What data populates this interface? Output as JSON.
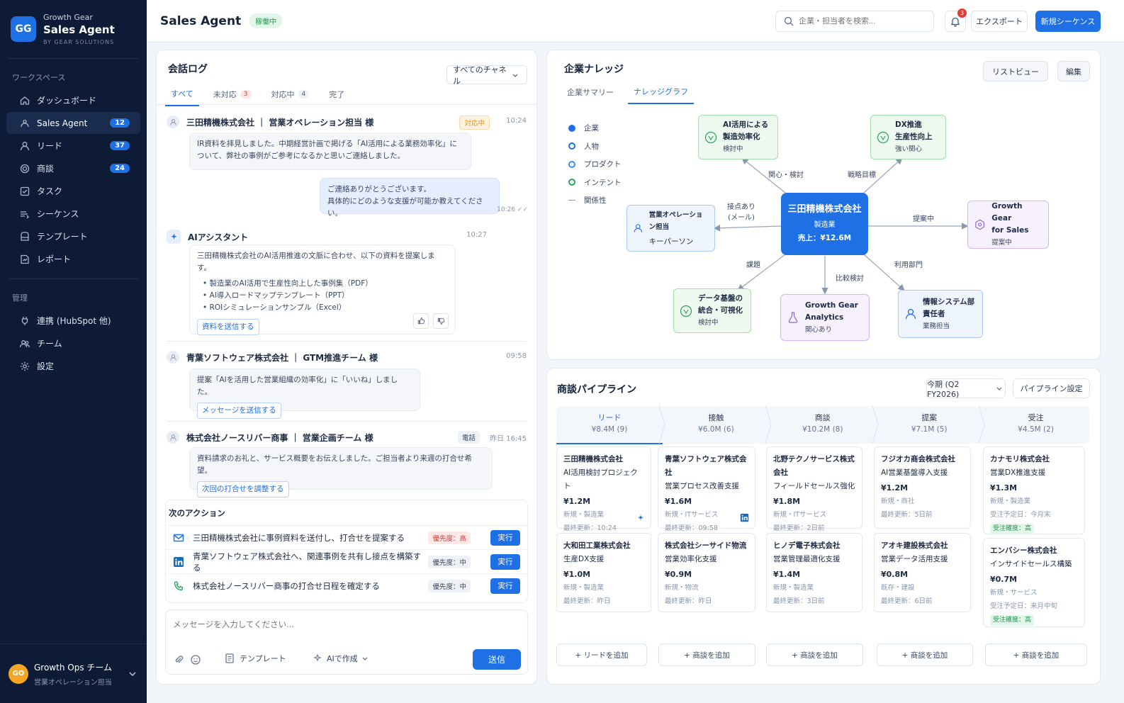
{
  "sidebar": {
    "logo": "GG",
    "brand_small": "Growth Gear",
    "brand_large": "Sales Agent",
    "brand_by": "BY GEAR SOLUTIONS",
    "workspace_label": "ワークスペース",
    "workspace_items": [
      {
        "label": "ダッシュボード",
        "icon": "home-icon"
      },
      {
        "label": "Sales Agent",
        "badge": "12",
        "icon": "agent-icon"
      },
      {
        "label": "リード",
        "badge": "37",
        "icon": "person-icon"
      },
      {
        "label": "商談",
        "badge": "24",
        "icon": "target-icon"
      },
      {
        "label": "タスク",
        "icon": "task-icon"
      },
      {
        "label": "シーケンス",
        "icon": "sequence-icon"
      },
      {
        "label": "テンプレート",
        "icon": "template-icon"
      },
      {
        "label": "レポート",
        "icon": "report-icon"
      }
    ],
    "admin_label": "管理",
    "admin_items": [
      {
        "label": "連携 (HubSpot 他)",
        "icon": "plug-icon"
      },
      {
        "label": "チーム",
        "icon": "team-icon"
      },
      {
        "label": "設定",
        "icon": "gear-icon"
      }
    ],
    "user": {
      "avatar": "GO",
      "name": "Growth Ops チーム",
      "role": "営業オペレーション担当"
    }
  },
  "topbar": {
    "title": "Sales Agent",
    "status": "稼働中",
    "search_placeholder": "企業・担当者を検索...",
    "notif_count": "3",
    "export": "エクスポート",
    "new_sequence": "新規シーケンス"
  },
  "conversation": {
    "title": "会話ログ",
    "channel_filter": "すべてのチャネル",
    "tabs": [
      {
        "label": "すべて"
      },
      {
        "label": "未対応",
        "count": "3"
      },
      {
        "label": "対応中",
        "count": "4"
      },
      {
        "label": "完了"
      }
    ],
    "thread1": {
      "name": "三田精機株式会社 ｜ 営業オペレーション担当 様",
      "tag": "対応中",
      "time": "10:24",
      "message": "IR資料を拝見しました。中期経営計画で掲げる「AI活用による業務効率化」について、弊社の事例がご参考になるかと思いご連絡しました。",
      "reply": "ご連絡ありがとうございます。\n具体的にどのような支援が可能か教えてください。",
      "reply_time": "10:26 ✓✓"
    },
    "assistant": {
      "name": "AIアシスタント",
      "time": "10:27",
      "intro": "三田精機株式会社のAI活用推進の文脈に合わせ、以下の資料を提案します。",
      "items": [
        "製造業のAI活用で生産性向上した事例集（PDF）",
        "AI導入ロードマップテンプレート（PPT）",
        "ROIシミュレーションサンプル（Excel）"
      ],
      "action": "資料を送信する"
    },
    "thread2": {
      "name": "青葉ソフトウェア株式会社 ｜ GTM推進チーム 様",
      "time": "09:58",
      "message": "提案「AIを活用した営業組織の効率化」に「いいね」しました。",
      "action": "メッセージを送信する"
    },
    "thread3": {
      "name": "株式会社ノースリバー商事 ｜ 営業企画チーム 様",
      "tag": "電話",
      "time": "昨日 16:45",
      "message": "資料請求のお礼と、サービス概要をお伝えしました。ご担当者より来週の打合せ希望。",
      "action": "次回の打合せを調整する"
    },
    "next_actions": {
      "title": "次のアクション",
      "items": [
        {
          "icon": "mail-icon",
          "text": "三田精機株式会社に事例資料を送付し、打合せを提案する",
          "priority": "優先度：高",
          "run": "実行"
        },
        {
          "icon": "linkedin-icon",
          "text": "青葉ソフトウェア株式会社へ、関連事例を共有し接点を構築する",
          "priority": "優先度：中",
          "run": "実行"
        },
        {
          "icon": "phone-icon",
          "text": "株式会社ノースリバー商事の打合せ日程を確定する",
          "priority": "優先度：中",
          "run": "実行"
        }
      ]
    },
    "composer": {
      "placeholder": "メッセージを入力してください...",
      "template": "テンプレート",
      "ai_compose": "AIで作成",
      "send": "送信"
    }
  },
  "knowledge": {
    "title": "企業ナレッジ",
    "list_view": "リストビュー",
    "edit": "編集",
    "tabs": [
      "企業サマリー",
      "ナレッジグラフ"
    ],
    "legend": [
      "企業",
      "人物",
      "プロダクト",
      "インテント",
      "関係性"
    ],
    "center": {
      "name": "三田精機株式会社",
      "industry": "製造業",
      "sales": "売上：¥12.6M"
    },
    "nodes": {
      "ai": [
        "AI活用による",
        "製造効率化",
        "検討中"
      ],
      "dx": [
        "DX推進",
        "生産性向上",
        "強い関心"
      ],
      "ops": [
        "営業オペレーション担当",
        "キーパーソン"
      ],
      "gg_sales": [
        "Growth Gear",
        "for Sales",
        "提案中"
      ],
      "data": [
        "データ基盤の",
        "統合・可視化",
        "検討中"
      ],
      "gg_analytics": [
        "Growth Gear",
        "Analytics",
        "関心あり"
      ],
      "info": [
        "情報システム部",
        "責任者",
        "業務担当"
      ]
    },
    "edges": {
      "interest": "関心・検討",
      "strategy": "戦略目標",
      "contact": "接点あり\n(メール)",
      "proposing": "提案中",
      "issue": "課題",
      "compare": "比較検討",
      "dept": "利用部門"
    }
  },
  "pipeline": {
    "title": "商談パイプライン",
    "period": "今期 (Q2 FY2026)",
    "settings": "パイプライン設定",
    "stages": [
      {
        "name": "リード",
        "value": "¥8.4M (9)"
      },
      {
        "name": "接触",
        "value": "¥6.0M (6)"
      },
      {
        "name": "商談",
        "value": "¥10.2M (8)"
      },
      {
        "name": "提案",
        "value": "¥7.1M (5)"
      },
      {
        "name": "受注",
        "value": "¥4.5M (2)"
      }
    ],
    "cards": [
      [
        {
          "company": "三田精機株式会社",
          "deal": "AI活用検討プロジェクト",
          "amount": "¥1.2M",
          "meta": "新規・製造業",
          "updated": "最終更新：10:24"
        },
        {
          "company": "大和田工業株式会社",
          "deal": "生産DX支援",
          "amount": "¥1.0M",
          "meta": "新規・製造業",
          "updated": "最終更新：昨日"
        }
      ],
      [
        {
          "company": "青葉ソフトウェア株式会社",
          "deal": "営業プロセス改善支援",
          "amount": "¥1.6M",
          "meta": "新規・ITサービス",
          "updated": "最終更新：09:58"
        },
        {
          "company": "株式会社シーサイド物流",
          "deal": "営業効率化支援",
          "amount": "¥0.9M",
          "meta": "新規・物流",
          "updated": "最終更新：昨日"
        }
      ],
      [
        {
          "company": "北野テクノサービス株式会社",
          "deal": "フィールドセールス強化",
          "amount": "¥1.8M",
          "meta": "新規・ITサービス",
          "updated": "最終更新：2日前"
        },
        {
          "company": "ヒノデ電子株式会社",
          "deal": "営業管理最適化支援",
          "amount": "¥1.4M",
          "meta": "新規・製造業",
          "updated": "最終更新：3日前"
        }
      ],
      [
        {
          "company": "フジオカ商会株式会社",
          "deal": "AI営業基盤導入支援",
          "amount": "¥1.2M",
          "meta": "新規・商社",
          "updated": "最終更新：5日前"
        },
        {
          "company": "アオキ建設株式会社",
          "deal": "営業データ活用支援",
          "amount": "¥0.8M",
          "meta": "既存・建設",
          "updated": "最終更新：6日前"
        }
      ],
      [
        {
          "company": "カナモリ株式会社",
          "deal": "営業DX推進支援",
          "amount": "¥1.3M",
          "meta": "新規・製造業",
          "updated": "受注予定日：今月末",
          "tag": "受注確度：高"
        },
        {
          "company": "エンバシー株式会社",
          "deal": "インサイドセールス構築",
          "amount": "¥0.7M",
          "meta": "新規・サービス",
          "updated": "受注予定日：来月中旬",
          "tag": "受注確度：高"
        }
      ]
    ],
    "add_buttons": [
      "+ リードを追加",
      "+ 商談を追加",
      "+ 商談を追加",
      "+ 商談を追加",
      "+ 商談を追加"
    ]
  }
}
